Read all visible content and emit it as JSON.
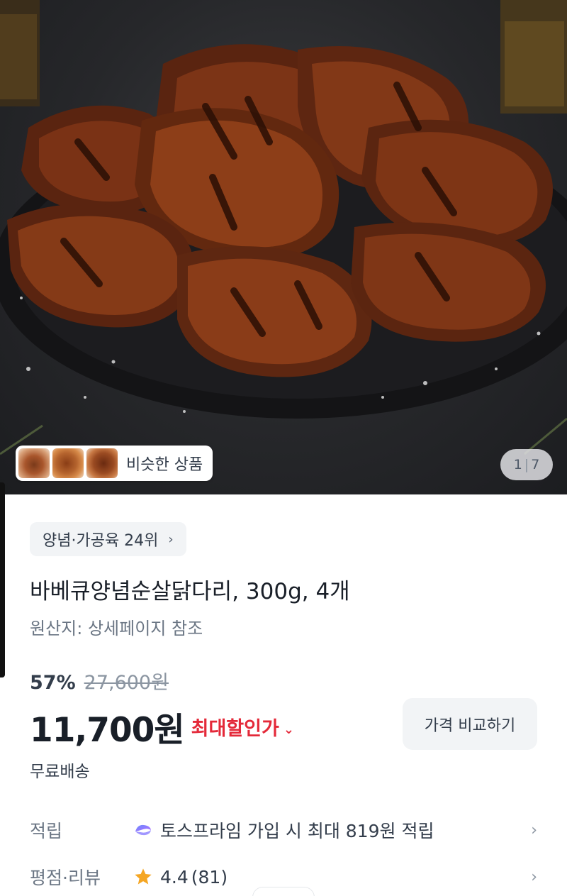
{
  "hero": {
    "image_alt": "bbq marinated chicken thighs on a black plate",
    "similar_products_label": "비슷한 상품",
    "page_current": "1",
    "page_total": "7"
  },
  "category_rank": {
    "label": "양념·가공육 24위",
    "chevron": "›"
  },
  "product": {
    "title": "바베큐양념순살닭다리, 300g, 4개",
    "origin": "원산지: 상세페이지 참조",
    "discount_rate": "57%",
    "original_price": "27,600원",
    "price": "11,700원",
    "max_discount_label": "최대할인가",
    "compare_button": "가격 비교하기",
    "shipping": "무료배송"
  },
  "points": {
    "label": "적립",
    "icon": "toss-prime-icon",
    "text": "토스프라임 가입 시 최대 819원 적립"
  },
  "rating": {
    "label": "평점·리뷰",
    "icon": "star-icon",
    "score": "4.4",
    "count": "(81)"
  },
  "colors": {
    "accent_red": "#e42939",
    "chip_bg": "#f2f4f6",
    "text_primary": "#191f28",
    "text_secondary": "#6b7684",
    "star": "#f5a623"
  }
}
